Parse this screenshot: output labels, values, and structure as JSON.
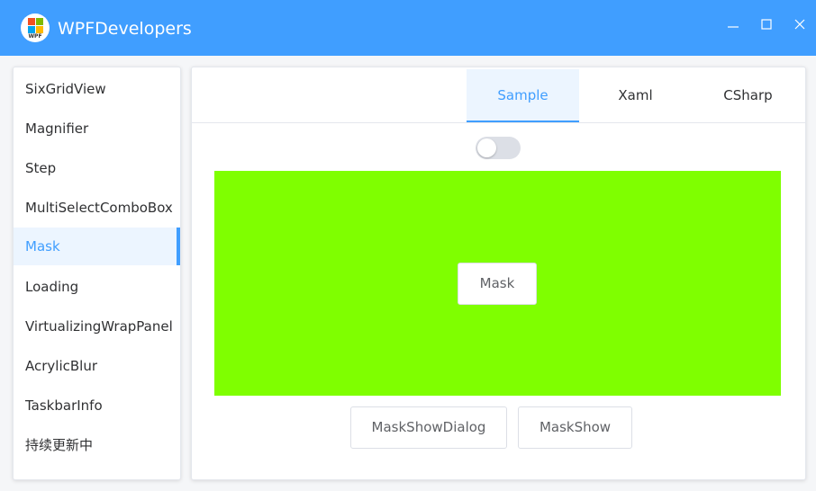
{
  "window": {
    "title": "WPFDevelopers",
    "logo_text": "WPF",
    "accent": "#409eff"
  },
  "sidebar": {
    "items": [
      {
        "label": "SixGridView"
      },
      {
        "label": "Magnifier"
      },
      {
        "label": "Step"
      },
      {
        "label": "MultiSelectComboBox"
      },
      {
        "label": "Mask",
        "selected": true
      },
      {
        "label": "Loading"
      },
      {
        "label": "VirtualizingWrapPanel"
      },
      {
        "label": "AcrylicBlur"
      },
      {
        "label": "TaskbarInfo"
      },
      {
        "label": "持续更新中"
      }
    ]
  },
  "tabs": [
    {
      "label": "Sample",
      "selected": true
    },
    {
      "label": "Xaml"
    },
    {
      "label": "CSharp"
    }
  ],
  "sample": {
    "toggle_on": false,
    "panel_color": "#7fff00",
    "mask_button": "Mask",
    "mask_show_dialog_button": "MaskShowDialog",
    "mask_show_button": "MaskShow"
  }
}
